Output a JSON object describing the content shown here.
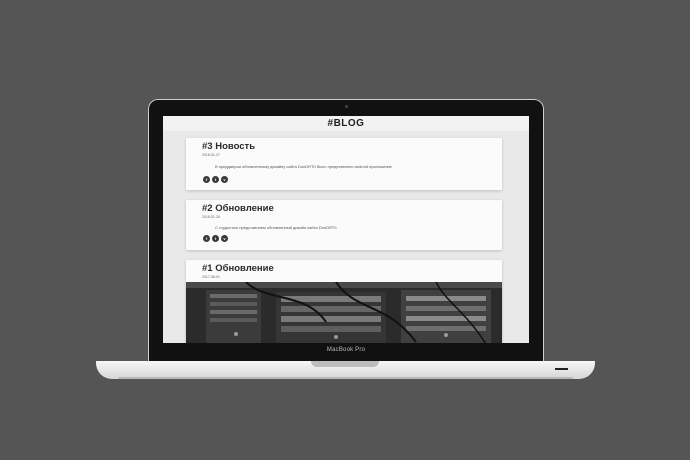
{
  "device": {
    "model_label": "MacBook Pro"
  },
  "site": {
    "logo": "#BLOG"
  },
  "posts": [
    {
      "title": "#3 Новость",
      "date": "2018-01-27",
      "text": "В преддверии обновленному дизайну сайта DonDRT0 было представлено android приложение",
      "share_icons": [
        "facebook-icon",
        "twitter-icon",
        "vk-icon"
      ]
    },
    {
      "title": "#2 Обновление",
      "date": "2018-01-26",
      "text": "С гордостью представляем обновленный дизайн сайта DonDRT0",
      "share_icons": [
        "facebook-icon",
        "twitter-icon",
        "vk-icon"
      ]
    },
    {
      "title": "#1 Обновление",
      "date": "2017-08-01",
      "image": "server-rack-photo"
    }
  ]
}
